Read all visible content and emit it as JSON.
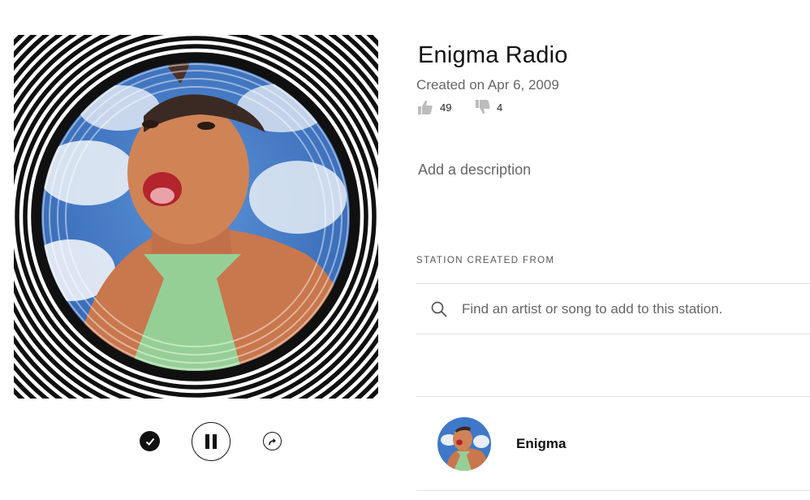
{
  "station": {
    "title": "Enigma Radio",
    "created": "Created on Apr 6, 2009",
    "likes": "49",
    "dislikes": "4",
    "add_description": "Add a description"
  },
  "section": {
    "created_from_label": "STATION CREATED FROM"
  },
  "search": {
    "placeholder": "Find an artist or song to add to this station."
  },
  "seed_artists": [
    {
      "name": "Enigma"
    }
  ],
  "icons": {
    "like": "thumbs-up-icon",
    "dislike": "thumbs-down-icon",
    "search": "search-icon",
    "added": "check-icon",
    "pause": "pause-icon",
    "share": "share-icon"
  },
  "colors": {
    "accent": "#111111",
    "text_secondary": "#666666",
    "divider": "#e1e1e1",
    "sky_blue": "#3f78c8",
    "tie_green": "#96cf96",
    "skin": "#d48656"
  }
}
